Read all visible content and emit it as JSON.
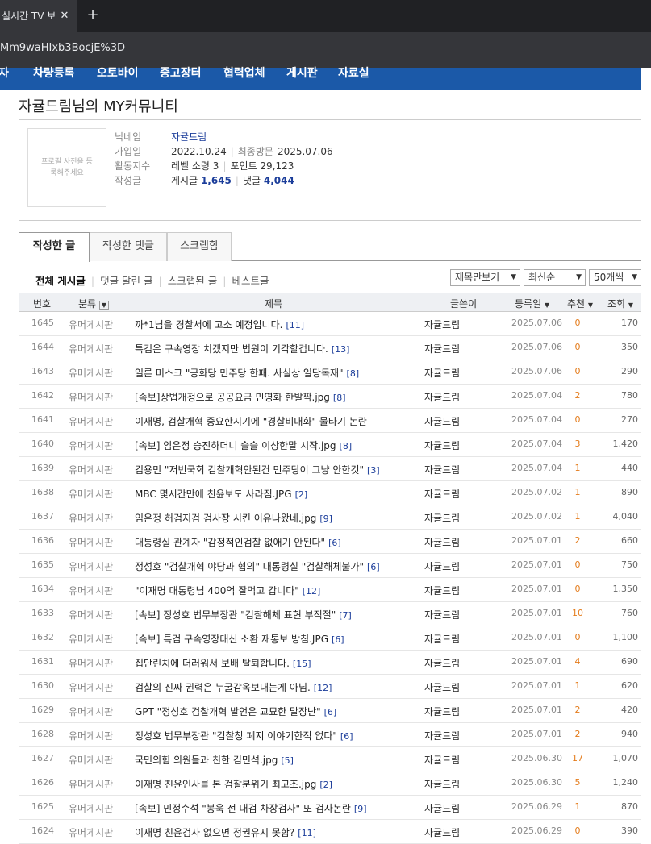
{
  "browser": {
    "tab_title": "실시간 TV 보",
    "address": "Mm9waHIxb3BocjE%3D"
  },
  "nav": {
    "items": [
      "자",
      "차량등록",
      "오토바이",
      "중고장터",
      "협력업체",
      "게시판",
      "자료실"
    ]
  },
  "page": {
    "title": "자귤드림님의 MY커뮤니티"
  },
  "profile": {
    "photo_placeholder": "프로필 사진을 등록해주세요",
    "nickname_label": "닉네임",
    "nickname": "자귤드림",
    "joined_label": "가입일",
    "joined": "2022.10.24",
    "last_visit_label": "최종방문",
    "last_visit": "2025.07.06",
    "activity_label": "활동지수",
    "level": "레벨 소령 3",
    "points": "포인트 29,123",
    "posts_label": "작성글",
    "post_count_label": "게시글",
    "post_count": "1,645",
    "comment_count_label": "댓글",
    "comment_count": "4,044"
  },
  "tabs": {
    "written_posts": "작성한 글",
    "written_comments": "작성한 댓글",
    "scrap": "스크랩함"
  },
  "filters": {
    "all": "전체 게시글",
    "commented": "댓글 달린 글",
    "scrapped": "스크랩된 글",
    "best": "베스트글"
  },
  "controls": {
    "view_mode": "제목만보기",
    "sort": "최신순",
    "page_size": "50개씩"
  },
  "table": {
    "headers": {
      "num": "번호",
      "category": "분류",
      "title": "제목",
      "author": "글쓴이",
      "date": "등록일",
      "recommend": "추천",
      "views": "조회"
    },
    "rows": [
      {
        "num": "1645",
        "cat": "유머게시판",
        "title": "까*1님을 경찰서에 고소 예정입니다.",
        "cmt": "[11]",
        "author": "자귤드림",
        "date": "2025.07.06",
        "rec": "0",
        "views": "170"
      },
      {
        "num": "1644",
        "cat": "유머게시판",
        "title": "특검은 구속영장 치겠지만 법원이 기각할겁니다.",
        "cmt": "[13]",
        "author": "자귤드림",
        "date": "2025.07.06",
        "rec": "0",
        "views": "350"
      },
      {
        "num": "1643",
        "cat": "유머게시판",
        "title": "일론 머스크 \"공화당 민주당 한패. 사실상 일당독재\"",
        "cmt": "[8]",
        "author": "자귤드림",
        "date": "2025.07.06",
        "rec": "0",
        "views": "290"
      },
      {
        "num": "1642",
        "cat": "유머게시판",
        "title": "[속보]상법개정으로 공공요금 민영화 한발짝.jpg",
        "cmt": "[8]",
        "author": "자귤드림",
        "date": "2025.07.04",
        "rec": "2",
        "views": "780"
      },
      {
        "num": "1641",
        "cat": "유머게시판",
        "title": "이재명, 검찰개혁 중요한시기에 \"경찰비대화\" 물타기 논란",
        "cmt": "",
        "author": "자귤드림",
        "date": "2025.07.04",
        "rec": "0",
        "views": "270"
      },
      {
        "num": "1640",
        "cat": "유머게시판",
        "title": "[속보] 임은정 승진하더니 슬슬 이상한말 시작.jpg",
        "cmt": "[8]",
        "author": "자귤드림",
        "date": "2025.07.04",
        "rec": "3",
        "views": "1,420"
      },
      {
        "num": "1639",
        "cat": "유머게시판",
        "title": "김용민 \"저번국회 검찰개혁안된건 민주당이 그냥 안한것\"",
        "cmt": "[3]",
        "author": "자귤드림",
        "date": "2025.07.04",
        "rec": "1",
        "views": "440"
      },
      {
        "num": "1638",
        "cat": "유머게시판",
        "title": "MBC 몇시간만에 친윤보도 사라짐.JPG",
        "cmt": "[2]",
        "author": "자귤드림",
        "date": "2025.07.02",
        "rec": "1",
        "views": "890"
      },
      {
        "num": "1637",
        "cat": "유머게시판",
        "title": "임은정 허검지검 검사장 시킨 이유나왔네.jpg",
        "cmt": "[9]",
        "author": "자귤드림",
        "date": "2025.07.02",
        "rec": "1",
        "views": "4,040"
      },
      {
        "num": "1636",
        "cat": "유머게시판",
        "title": "대통령실 관계자 \"감정적인검찰 없애기 안된다\"",
        "cmt": "[6]",
        "author": "자귤드림",
        "date": "2025.07.01",
        "rec": "2",
        "views": "660"
      },
      {
        "num": "1635",
        "cat": "유머게시판",
        "title": "정성호 \"검찰개혁 야당과 협의\" 대통령실 \"검찰해체불가\"",
        "cmt": "[6]",
        "author": "자귤드림",
        "date": "2025.07.01",
        "rec": "0",
        "views": "750"
      },
      {
        "num": "1634",
        "cat": "유머게시판",
        "title": "\"이재명 대통령님 400억 잘먹고 갑니다\"",
        "cmt": "[12]",
        "author": "자귤드림",
        "date": "2025.07.01",
        "rec": "0",
        "views": "1,350"
      },
      {
        "num": "1633",
        "cat": "유머게시판",
        "title": "[속보] 정성호 법무부장관 \"검찰해체 표현 부적절\"",
        "cmt": "[7]",
        "author": "자귤드림",
        "date": "2025.07.01",
        "rec": "10",
        "views": "760"
      },
      {
        "num": "1632",
        "cat": "유머게시판",
        "title": "[속보] 특검 구속영장대신 소환 재통보 방침.JPG",
        "cmt": "[6]",
        "author": "자귤드림",
        "date": "2025.07.01",
        "rec": "0",
        "views": "1,100"
      },
      {
        "num": "1631",
        "cat": "유머게시판",
        "title": "집단린치에 더러워서 보배 탈퇴합니다.",
        "cmt": "[15]",
        "author": "자귤드림",
        "date": "2025.07.01",
        "rec": "4",
        "views": "690"
      },
      {
        "num": "1630",
        "cat": "유머게시판",
        "title": "검찰의 진짜 권력은 누굴감옥보내는게 아님.",
        "cmt": "[12]",
        "author": "자귤드림",
        "date": "2025.07.01",
        "rec": "1",
        "views": "620"
      },
      {
        "num": "1629",
        "cat": "유머게시판",
        "title": "GPT \"정성호 검찰개혁 발언은 교묘한 말장난\"",
        "cmt": "[6]",
        "author": "자귤드림",
        "date": "2025.07.01",
        "rec": "2",
        "views": "420"
      },
      {
        "num": "1628",
        "cat": "유머게시판",
        "title": "정성호 법무부장관 \"검찰청 폐지 이야기한적 없다\"",
        "cmt": "[6]",
        "author": "자귤드림",
        "date": "2025.07.01",
        "rec": "2",
        "views": "940"
      },
      {
        "num": "1627",
        "cat": "유머게시판",
        "title": "국민의힘 의원들과 친한 김민석.jpg",
        "cmt": "[5]",
        "author": "자귤드림",
        "date": "2025.06.30",
        "rec": "17",
        "views": "1,070"
      },
      {
        "num": "1626",
        "cat": "유머게시판",
        "title": "이재명 친윤인사를 본 검찰분위기 최고조.jpg",
        "cmt": "[2]",
        "author": "자귤드림",
        "date": "2025.06.30",
        "rec": "5",
        "views": "1,240"
      },
      {
        "num": "1625",
        "cat": "유머게시판",
        "title": "[속보] 민정수석 \"봉욱 전 대검 차장검사\" 또 검사논란",
        "cmt": "[9]",
        "author": "자귤드림",
        "date": "2025.06.29",
        "rec": "1",
        "views": "870"
      },
      {
        "num": "1624",
        "cat": "유머게시판",
        "title": "이재명 친윤검사 없으면 정권유지 못함?",
        "cmt": "[11]",
        "author": "자귤드림",
        "date": "2025.06.29",
        "rec": "0",
        "views": "390"
      }
    ]
  }
}
